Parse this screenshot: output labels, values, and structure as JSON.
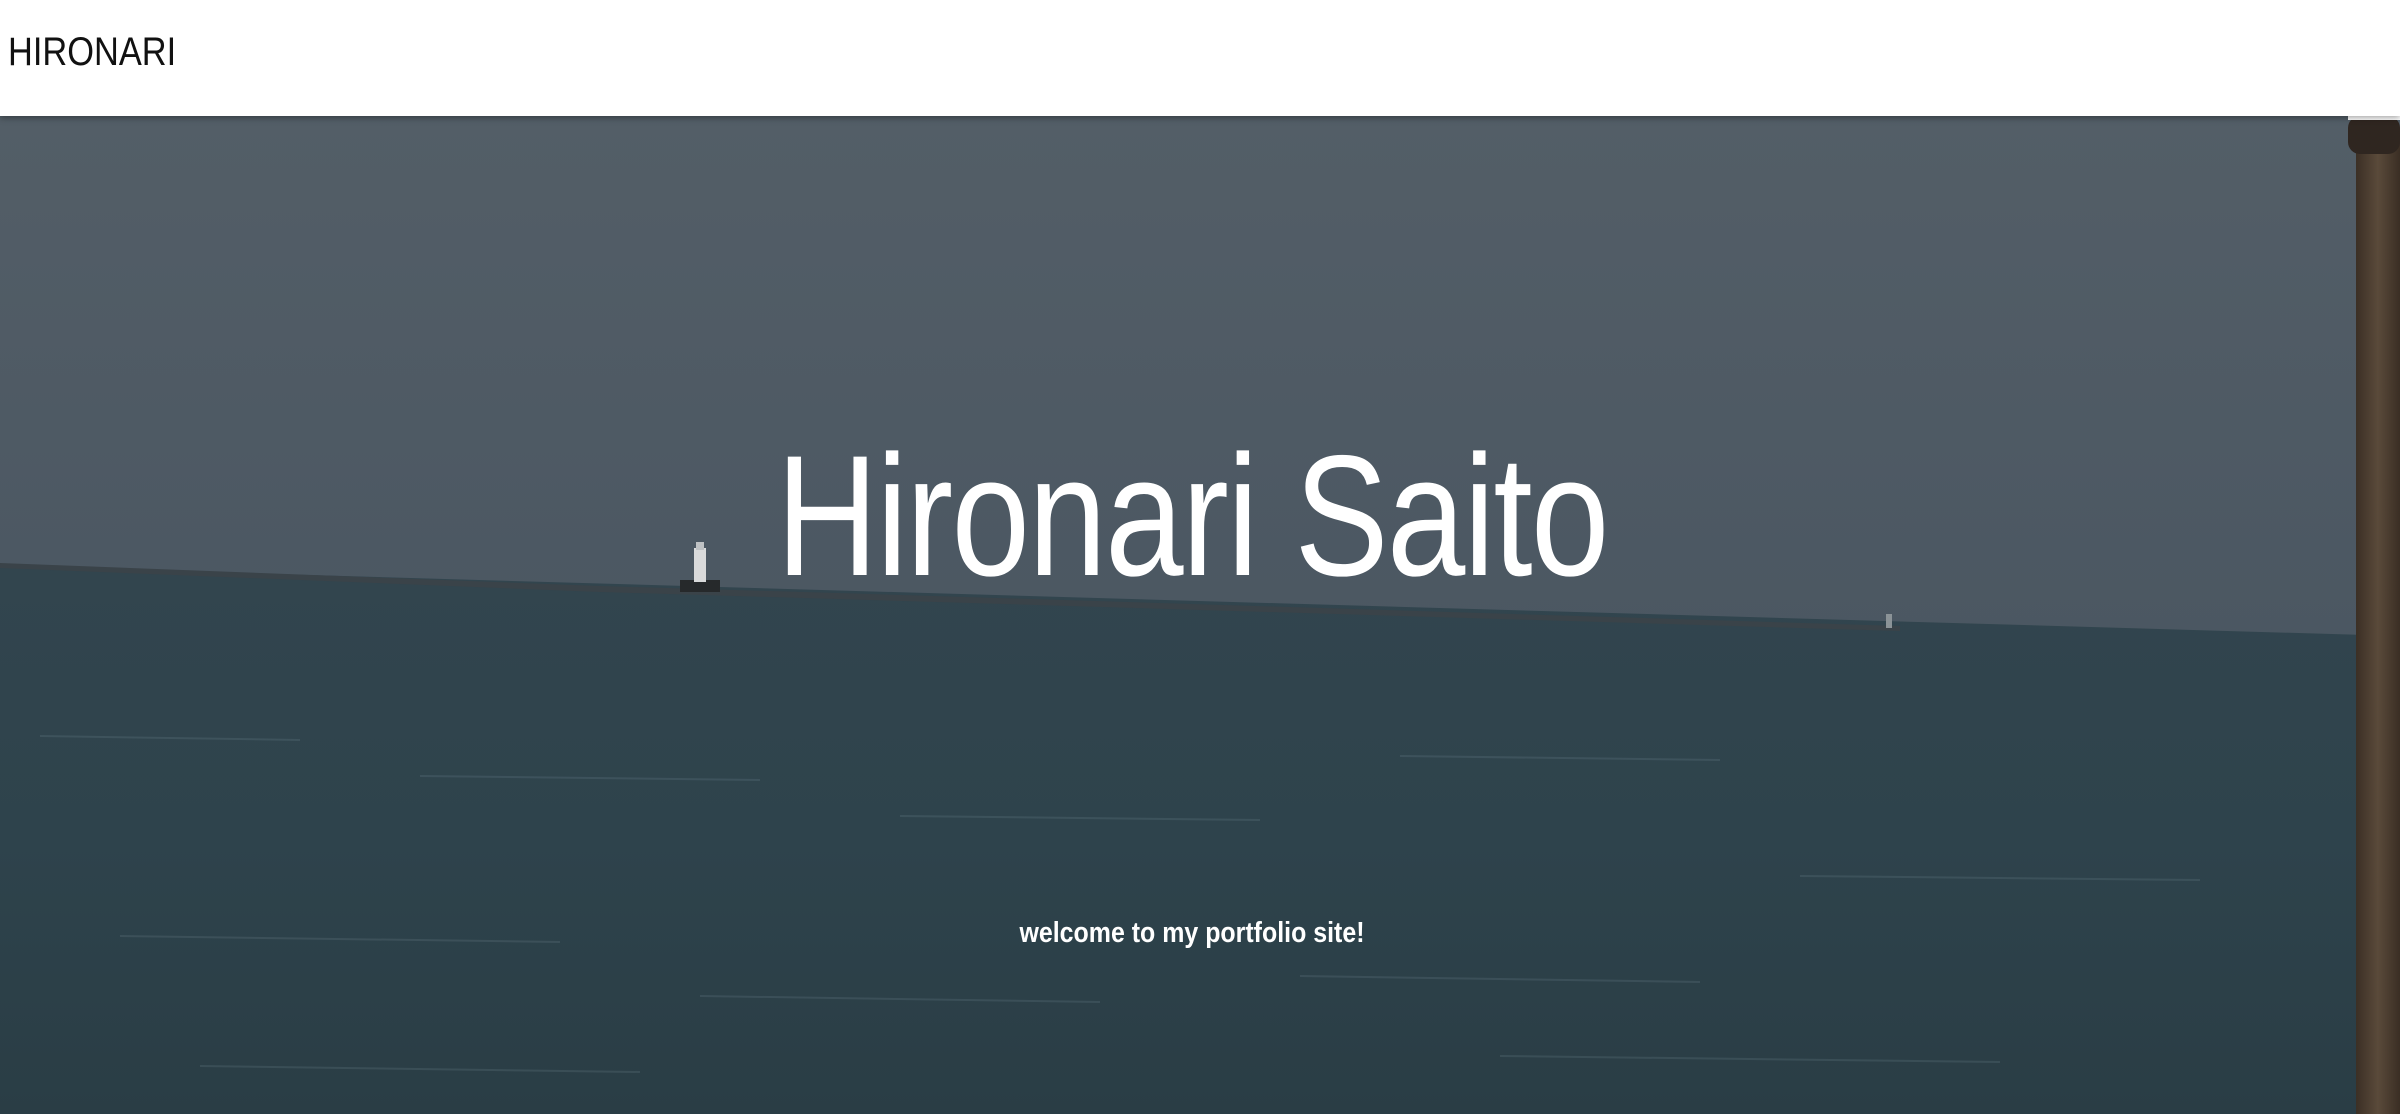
{
  "navbar": {
    "brand": "HIRONARI"
  },
  "hero": {
    "title": "Hironari Saito",
    "subtitle": "welcome to my portfolio site!",
    "background": {
      "sky_color": "#4f5a63",
      "sea_color": "#2d4048",
      "post_color": "#4a3a2c"
    }
  }
}
